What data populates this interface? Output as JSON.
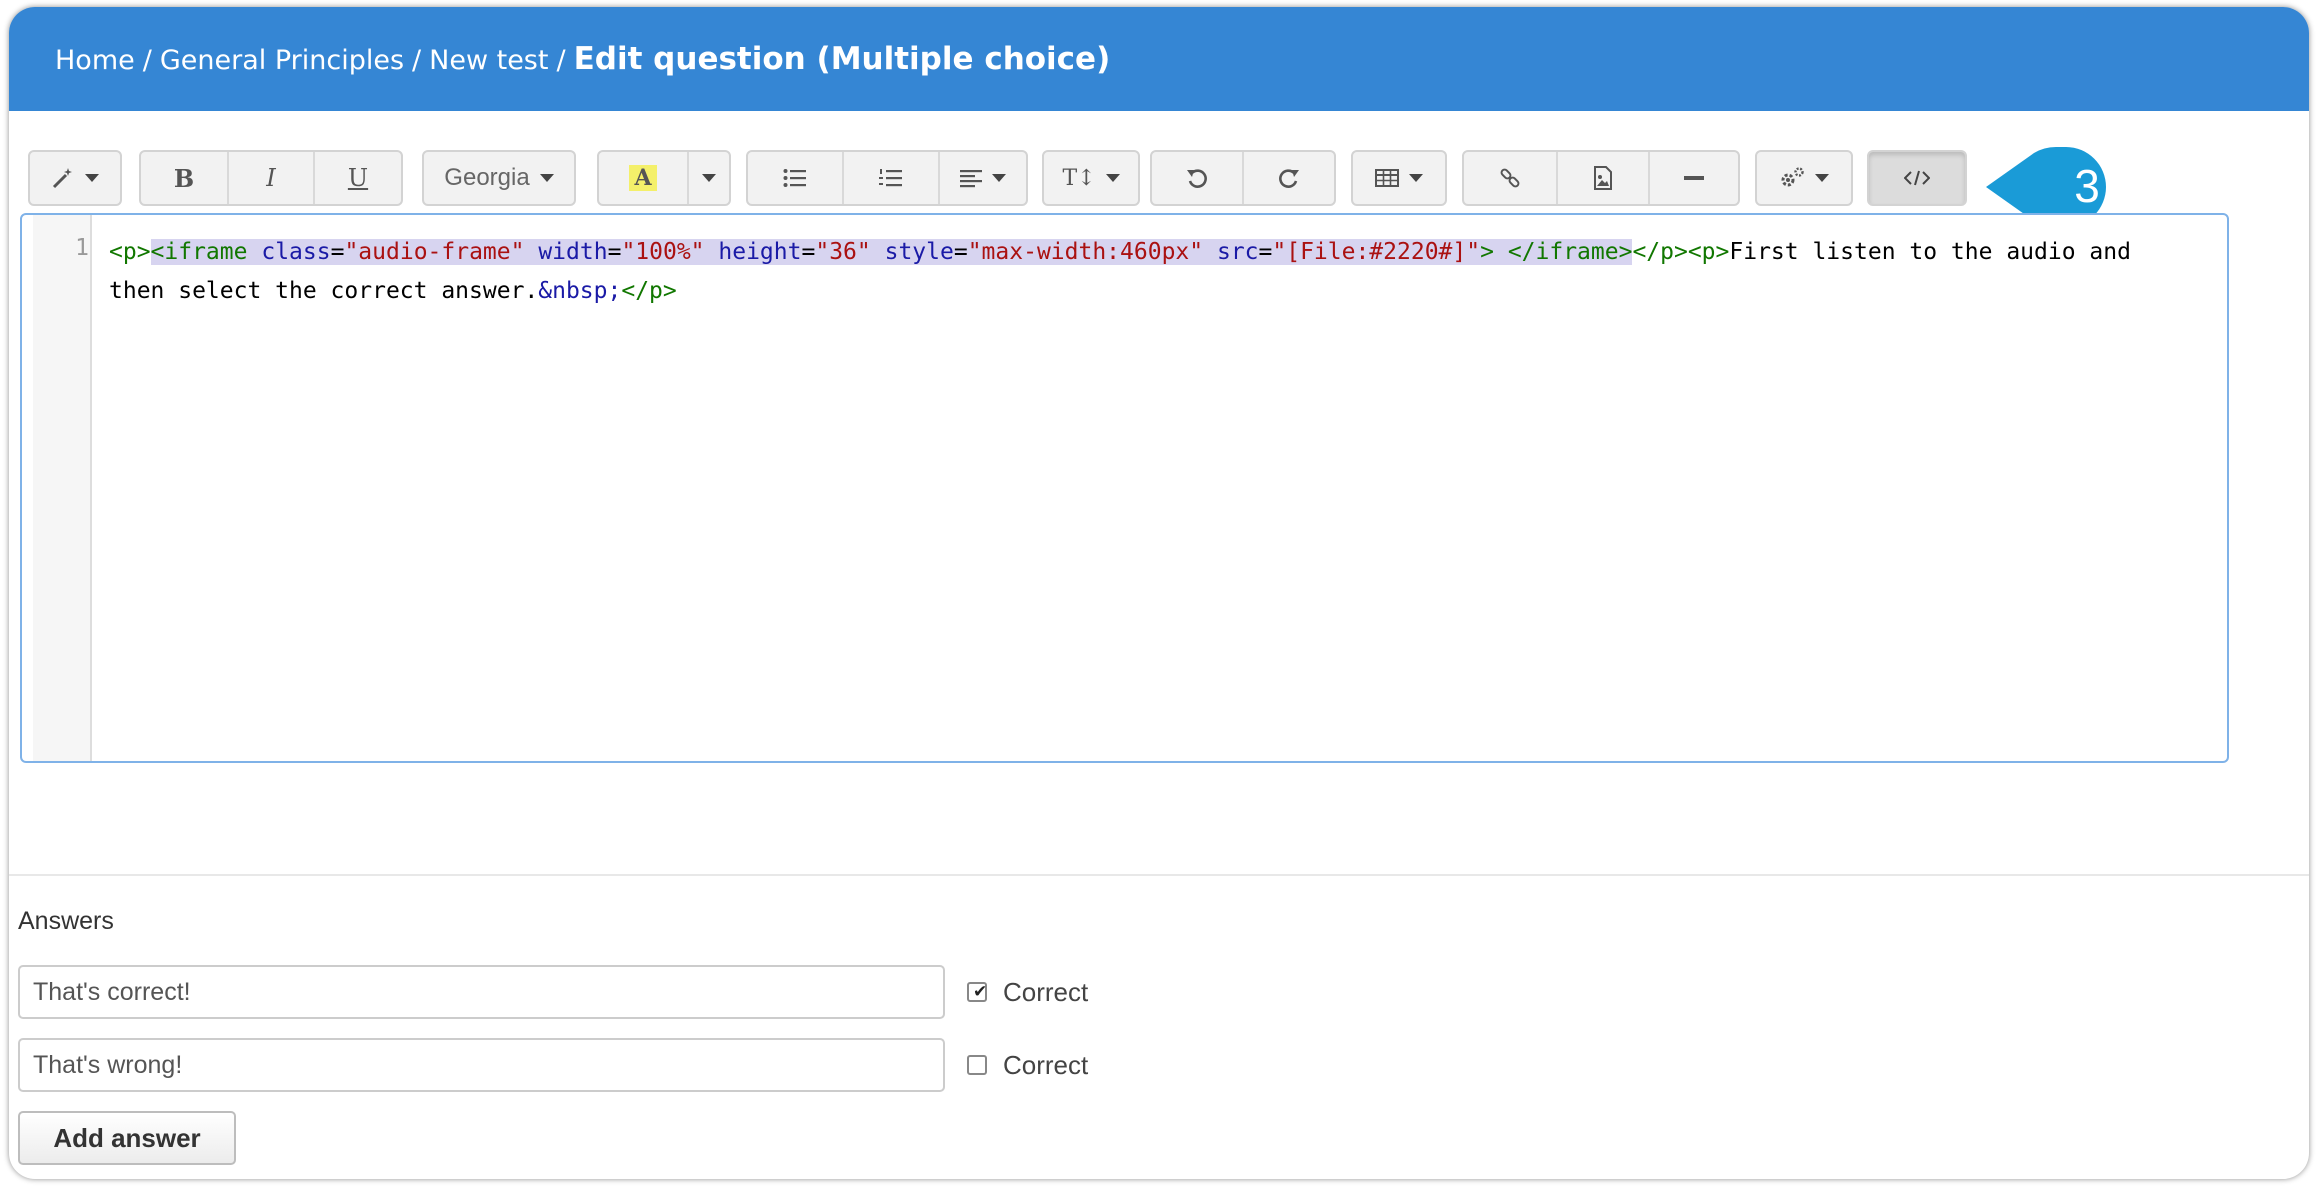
{
  "breadcrumb": {
    "home": "Home",
    "separator": "/",
    "level1": "General Principles",
    "level2": "New test",
    "current": "Edit question (Multiple choice)"
  },
  "toolbar": {
    "bold_label": "B",
    "italic_label": "I",
    "underline_label": "U",
    "font_name": "Georgia",
    "highlight_label": "A",
    "font_size_label": "T↕",
    "icons": [
      "magic-wand-icon",
      "bold-icon",
      "italic-icon",
      "underline-icon",
      "font-dropdown",
      "highlight-icon",
      "unordered-list-icon",
      "ordered-list-icon",
      "align-icon",
      "font-size-icon",
      "undo-icon",
      "redo-icon",
      "table-icon",
      "link-icon",
      "image-icon",
      "horizontal-rule-icon",
      "settings-icon",
      "code-view-icon"
    ]
  },
  "callout": {
    "number": "3",
    "color": "#1a9bd7"
  },
  "editor": {
    "line_number": "1",
    "code": {
      "p_open": "<p>",
      "iframe_open": "<iframe",
      "attr_class": "class",
      "val_class": "\"audio-frame\"",
      "attr_width": "width",
      "val_width": "\"100%\"",
      "attr_height": "height",
      "val_height": "\"36\"",
      "attr_style": "style",
      "val_style": "\"max-width:460px\"",
      "attr_src": "src",
      "val_src": "\"[File:#2220#]\"",
      "iframe_gt": ">",
      "iframe_close": "</iframe>",
      "p_close1": "</p>",
      "p_open2": "<p>",
      "text": "First listen to the audio and then select the correct answer.",
      "entity": "&nbsp;",
      "p_close2": "</p>"
    }
  },
  "answers": {
    "label": "Answers",
    "items": [
      {
        "value": "That's correct!",
        "correct_label": "Correct",
        "checked": true
      },
      {
        "value": "That's wrong!",
        "correct_label": "Correct",
        "checked": false
      }
    ],
    "add_label": "Add answer"
  },
  "colors": {
    "header": "#3586d4",
    "accent": "#1a9bd7"
  }
}
